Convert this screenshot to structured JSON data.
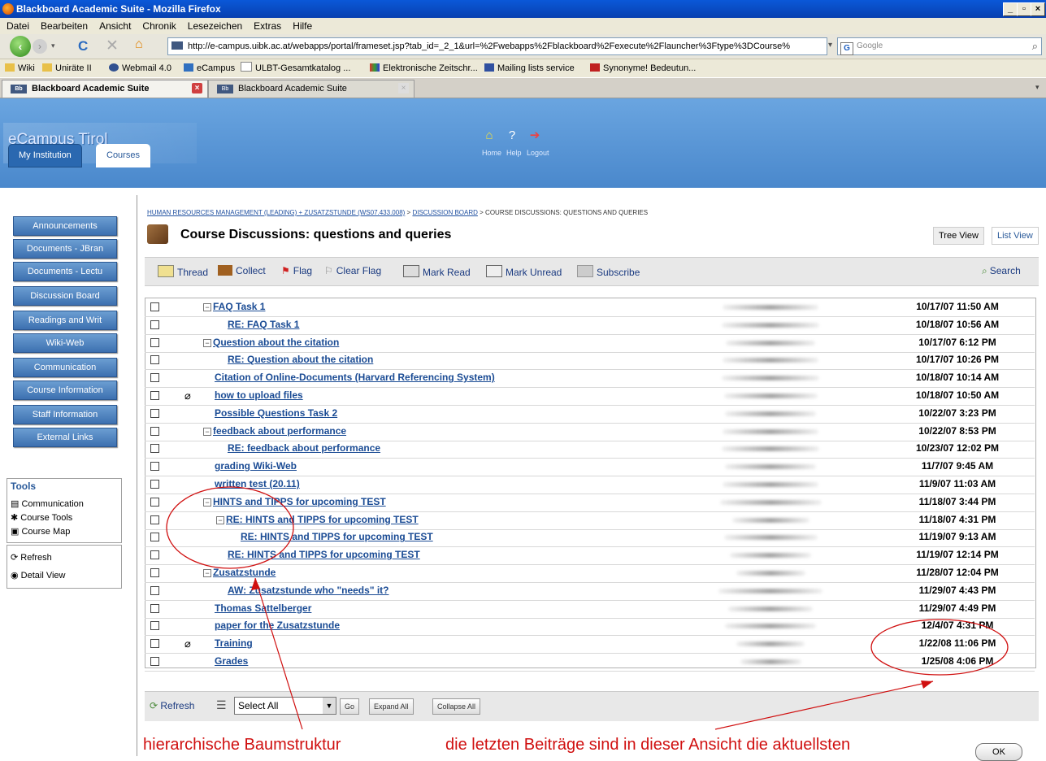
{
  "window": {
    "title": "Blackboard Academic Suite - Mozilla Firefox"
  },
  "menu": [
    "Datei",
    "Bearbeiten",
    "Ansicht",
    "Chronik",
    "Lesezeichen",
    "Extras",
    "Hilfe"
  ],
  "address": {
    "url": "http://e-campus.uibk.ac.at/webapps/portal/frameset.jsp?tab_id=_2_1&url=%2Fwebapps%2Fblackboard%2Fexecute%2Flauncher%3Ftype%3DCourse%",
    "search_placeholder": "Google"
  },
  "bookmarks": [
    "Wiki",
    "Uniräte II",
    "Webmail 4.0",
    "eCampus",
    "ULBT-Gesamtkatalog ...",
    "Elektronische Zeitschr...",
    "Mailing lists service",
    "Synonyme! Bedeutun..."
  ],
  "tabs": [
    "Blackboard Academic Suite",
    "Blackboard Academic Suite"
  ],
  "header": {
    "logo": "eCampus Tirol",
    "home": "Home",
    "help": "Help",
    "logout": "Logout",
    "tab_institution": "My Institution",
    "tab_courses": "Courses"
  },
  "sidenav": [
    "Announcements",
    "Documents - JBran",
    "Documents - Lectu",
    "Discussion Board",
    "Readings and Writ",
    "Wiki-Web",
    "Communication",
    "Course Information",
    "Staff Information",
    "External Links"
  ],
  "tools": {
    "title": "Tools",
    "items": [
      "Communication",
      "Course Tools",
      "Course Map"
    ],
    "refresh": "Refresh",
    "detail_view": "Detail View"
  },
  "breadcrumb": {
    "course": "HUMAN RESOURCES MANAGEMENT (LEADING) + ZUSATZSTUNDE (WS07.433.008)",
    "sep": " > ",
    "board": "DISCUSSION BOARD",
    "current": "COURSE DISCUSSIONS: QUESTIONS AND QUERIES"
  },
  "page_title": "Course Discussions: questions and queries",
  "views": {
    "tree": "Tree View",
    "list": "List View"
  },
  "actions": {
    "thread": "Thread",
    "collect": "Collect",
    "flag": "Flag",
    "clear_flag": "Clear Flag",
    "mark_read": "Mark Read",
    "mark_unread": "Mark Unread",
    "subscribe": "Subscribe",
    "search": "Search"
  },
  "threads": [
    {
      "subject": "FAQ Task 1",
      "level": 1,
      "expander": true,
      "date": "10/17/07 11:50 AM"
    },
    {
      "subject": "RE: FAQ Task 1",
      "level": 2,
      "expander": false,
      "date": "10/18/07 10:56 AM"
    },
    {
      "subject": "Question about the citation",
      "level": 1,
      "expander": true,
      "date": "10/17/07 6:12 PM"
    },
    {
      "subject": "RE: Question about the citation",
      "level": 2,
      "expander": false,
      "date": "10/17/07 10:26 PM"
    },
    {
      "subject": "Citation of Online-Documents (Harvard Referencing System)",
      "level": 1,
      "expander": false,
      "date": "10/18/07 10:14 AM"
    },
    {
      "subject": "how to upload files",
      "level": 1,
      "expander": false,
      "attachment": true,
      "date": "10/18/07 10:50 AM"
    },
    {
      "subject": "Possible Questions Task 2",
      "level": 1,
      "expander": false,
      "date": "10/22/07 3:23 PM"
    },
    {
      "subject": "feedback about performance",
      "level": 1,
      "expander": true,
      "date": "10/22/07 8:53 PM"
    },
    {
      "subject": "RE: feedback about performance",
      "level": 2,
      "expander": false,
      "date": "10/23/07 12:02 PM"
    },
    {
      "subject": "grading Wiki-Web",
      "level": 1,
      "expander": false,
      "date": "11/7/07 9:45 AM"
    },
    {
      "subject": "written test (20.11)",
      "level": 1,
      "expander": false,
      "date": "11/9/07 11:03 AM"
    },
    {
      "subject": "HINTS and TIPPS for upcoming TEST",
      "level": 1,
      "expander": true,
      "date": "11/18/07 3:44 PM"
    },
    {
      "subject": "RE: HINTS and TIPPS for upcoming TEST",
      "level": 2,
      "expander": true,
      "date": "11/18/07 4:31 PM"
    },
    {
      "subject": "RE: HINTS and TIPPS for upcoming TEST",
      "level": 3,
      "expander": false,
      "date": "11/19/07 9:13 AM"
    },
    {
      "subject": "RE: HINTS and TIPPS for upcoming TEST",
      "level": 2,
      "expander": false,
      "date": "11/19/07 12:14 PM"
    },
    {
      "subject": "Zusatzstunde",
      "level": 1,
      "expander": true,
      "date": "11/28/07 12:04 PM"
    },
    {
      "subject": "AW: Zusatzstunde who \"needs\" it?",
      "level": 2,
      "expander": false,
      "date": "11/29/07 4:43 PM"
    },
    {
      "subject": "Thomas Sattelberger",
      "level": 1,
      "expander": false,
      "date": "11/29/07 4:49 PM"
    },
    {
      "subject": "paper for the Zusatzstunde",
      "level": 1,
      "expander": false,
      "date": "12/4/07 4:31 PM"
    },
    {
      "subject": "Training",
      "level": 1,
      "expander": false,
      "attachment": true,
      "date": "1/22/08 11:06 PM"
    },
    {
      "subject": "Grades",
      "level": 1,
      "expander": false,
      "date": "1/25/08 4:06 PM"
    }
  ],
  "bottom": {
    "refresh": "Refresh",
    "select": "Select All",
    "go": "Go",
    "expand": "Expand All",
    "collapse": "Collapse All"
  },
  "annotations": {
    "left": "hierarchische Baumstruktur",
    "right": "die letzten Beiträge sind in dieser Ansicht die aktuellsten"
  },
  "ok": "OK",
  "colors": {
    "accent": "#4a88cc",
    "link": "#1a4b94",
    "annotation": "#d01010"
  }
}
